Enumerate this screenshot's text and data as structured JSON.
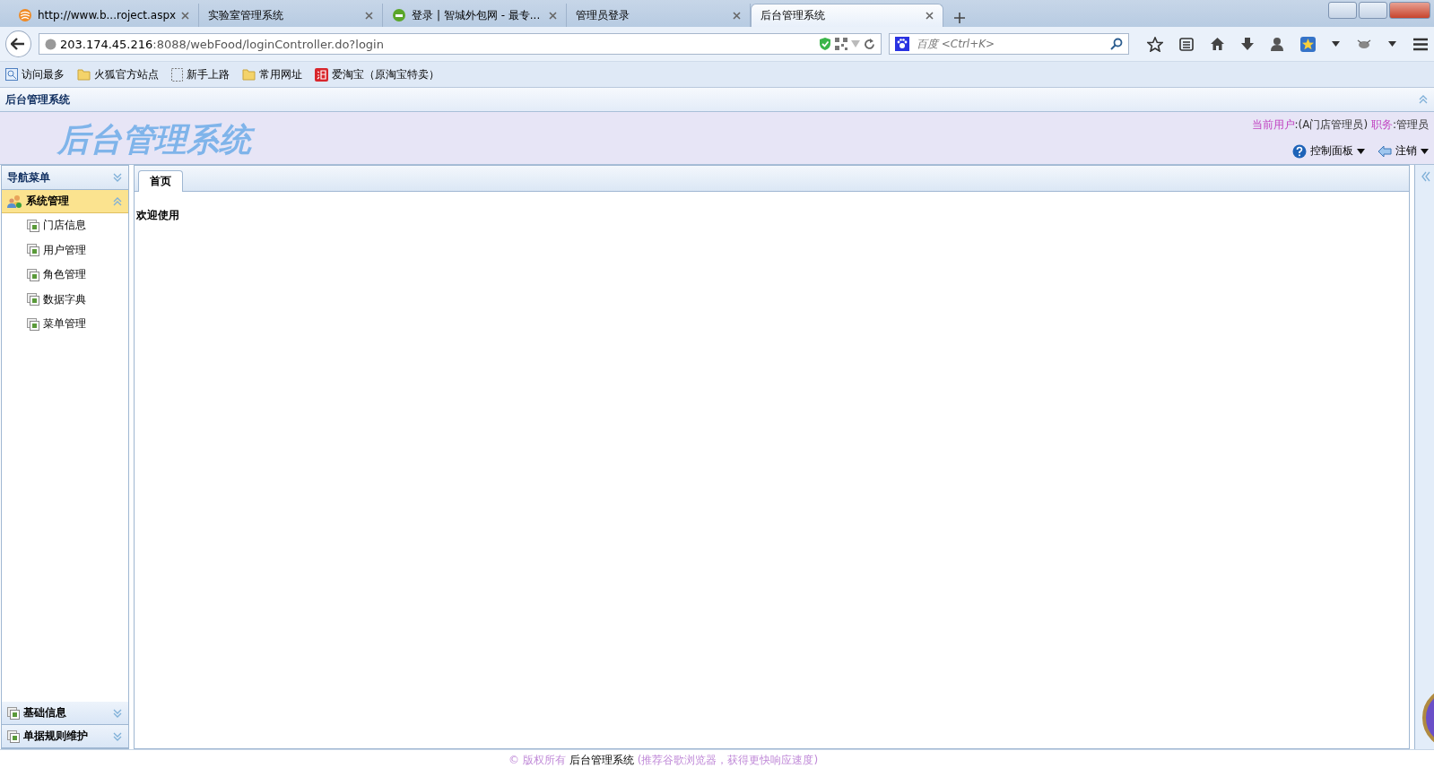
{
  "browser": {
    "tabs": [
      {
        "title": "http://www.b...roject.aspx",
        "selected": false
      },
      {
        "title": "实验室管理系统",
        "selected": false
      },
      {
        "title": "登录 | 智城外包网 - 最专...",
        "selected": false
      },
      {
        "title": "管理员登录",
        "selected": false
      },
      {
        "title": "后台管理系统",
        "selected": true
      }
    ],
    "address": {
      "host": "203.174.45.216",
      "path": ":8088/webFood/loginController.do?login"
    },
    "search": {
      "placeholder": "百度 <Ctrl+K>"
    },
    "bookmarks": [
      {
        "label": "访问最多"
      },
      {
        "label": "火狐官方站点"
      },
      {
        "label": "新手上路"
      },
      {
        "label": "常用网址"
      },
      {
        "label": "爱淘宝（原淘宝特卖）"
      }
    ]
  },
  "app": {
    "title": "后台管理系统",
    "logo": "后台管理系统",
    "user": {
      "user_label": "当前用户",
      "user_value": ":(A门店管理员)",
      "role_label": "职务",
      "role_value": ":管理员"
    },
    "menus": [
      {
        "label": "控制面板"
      },
      {
        "label": "注销"
      }
    ],
    "sidebar": {
      "title": "导航菜单",
      "groups": [
        {
          "label": "系统管理",
          "expanded": true,
          "children": [
            "门店信息",
            "用户管理",
            "角色管理",
            "数据字典",
            "菜单管理"
          ]
        },
        {
          "label": "基础信息",
          "expanded": false
        },
        {
          "label": "单据规则维护",
          "expanded": false
        }
      ]
    },
    "content_tabs": [
      {
        "label": "首页",
        "selected": true
      }
    ],
    "welcome": "欢迎使用"
  },
  "footer": {
    "copyright": "© 版权所有",
    "name": "后台管理系统",
    "hint": "(推荐谷歌浏览器，获得更快响应速度)"
  }
}
